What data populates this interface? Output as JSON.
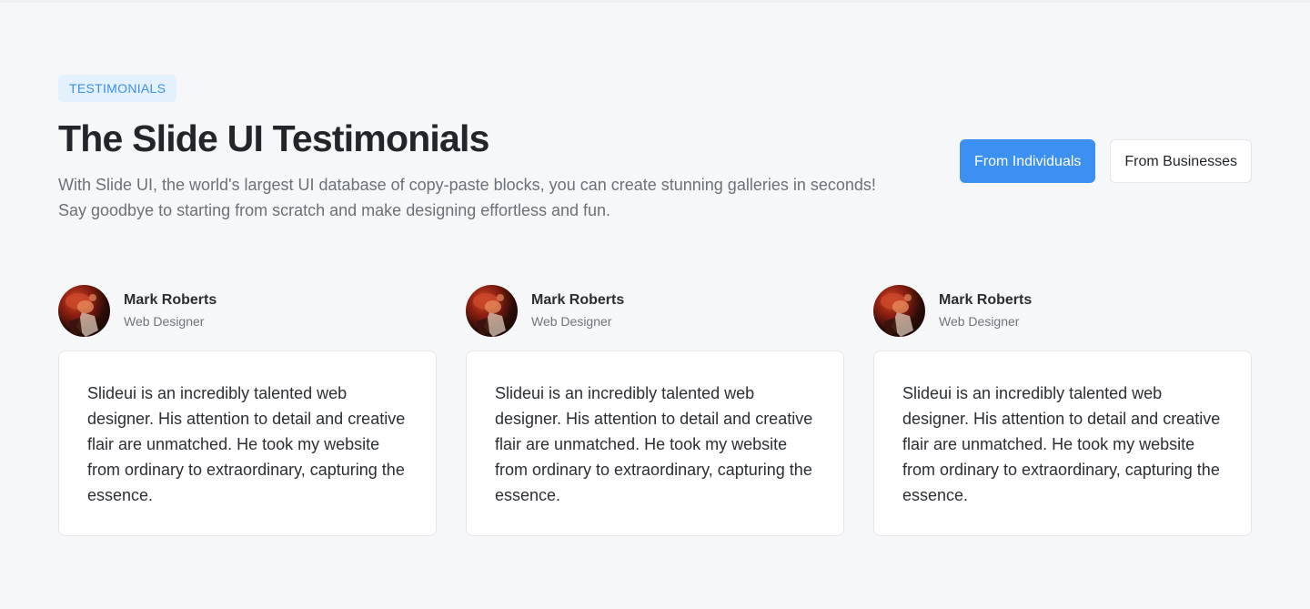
{
  "header": {
    "badge": "TESTIMONIALS",
    "title": "The Slide UI Testimonials",
    "subtitle": "With Slide UI, the world's largest UI database of copy-paste blocks, you can create stunning galleries in seconds! Say goodbye to starting from scratch and make designing effortless and fun."
  },
  "tabs": [
    {
      "label": "From Individuals",
      "active": true
    },
    {
      "label": "From Businesses",
      "active": false
    }
  ],
  "testimonials": [
    {
      "name": "Mark Roberts",
      "role": "Web Designer",
      "quote": "Slideui is an incredibly talented web designer. His attention to detail and creative flair are unmatched. He took my website from ordinary to extraordinary, capturing the essence."
    },
    {
      "name": "Mark Roberts",
      "role": "Web Designer",
      "quote": "Slideui is an incredibly talented web designer. His attention to detail and creative flair are unmatched. He took my website from ordinary to extraordinary, capturing the essence."
    },
    {
      "name": "Mark Roberts",
      "role": "Web Designer",
      "quote": "Slideui is an incredibly talented web designer. His attention to detail and creative flair are unmatched. He took my website from ordinary to extraordinary, capturing the essence."
    }
  ],
  "colors": {
    "accent": "#3c90f2",
    "badge_bg": "#e3f0fd",
    "badge_text": "#3b8fe8",
    "page_bg": "#f6f7f9"
  }
}
